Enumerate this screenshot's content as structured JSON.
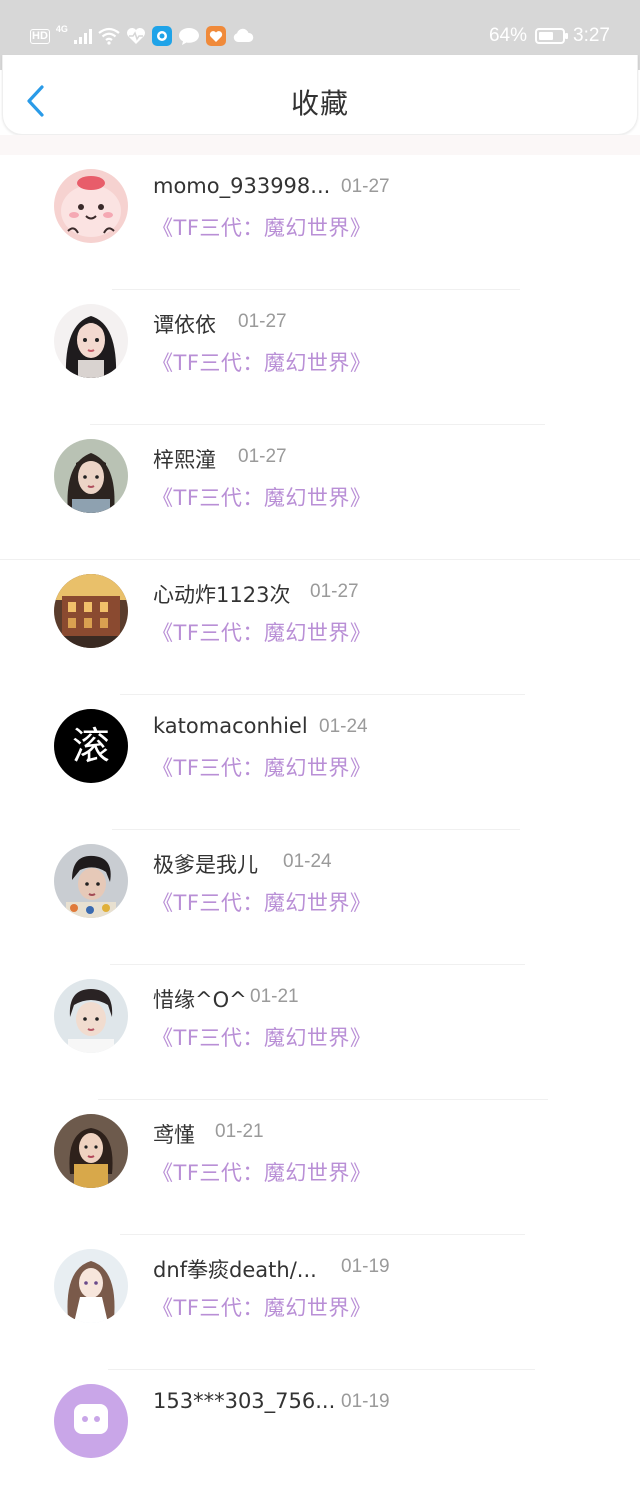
{
  "status_bar": {
    "hd": "HD",
    "network": "4G",
    "battery": "64%",
    "battery_level": 0.64,
    "time": "3:27"
  },
  "header": {
    "title": "收藏"
  },
  "favorites": [
    {
      "name": "momo_933998...",
      "date": "01-27",
      "work": "《TF三代：魔幻世界》",
      "avatar": "pink-cartoon"
    },
    {
      "name": "谭依依",
      "date": "01-27",
      "work": "《TF三代：魔幻世界》",
      "avatar": "anime-girl"
    },
    {
      "name": "梓熙潼",
      "date": "01-27",
      "work": "《TF三代：魔幻世界》",
      "avatar": "girl-photo"
    },
    {
      "name": "心动炸1123次",
      "date": "01-27",
      "work": "《TF三代：魔幻世界》",
      "avatar": "building-scene"
    },
    {
      "name": "katomaconhiel",
      "date": "01-24",
      "work": "《TF三代：魔幻世界》",
      "avatar": "black-logo"
    },
    {
      "name": "极爹是我儿",
      "date": "01-24",
      "work": "《TF三代：魔幻世界》",
      "avatar": "boy-photo"
    },
    {
      "name": "惜缘^O^",
      "date": "01-21",
      "work": "《TF三代：魔幻世界》",
      "avatar": "boy-portrait"
    },
    {
      "name": "鸢慬",
      "date": "01-21",
      "work": "《TF三代：魔幻世界》",
      "avatar": "woman-photo"
    },
    {
      "name": "dnf拳痰death/...",
      "date": "01-19",
      "work": "《TF三代：魔幻世界》",
      "avatar": "anime-white"
    },
    {
      "name": "153***303_756...",
      "date": "01-19",
      "work": "",
      "avatar": "purple-default"
    }
  ],
  "avatar_logo_text": "滚",
  "colors": {
    "accent": "#2a9be8",
    "work_title": "#b98fd6",
    "date": "#9a9a9a"
  }
}
